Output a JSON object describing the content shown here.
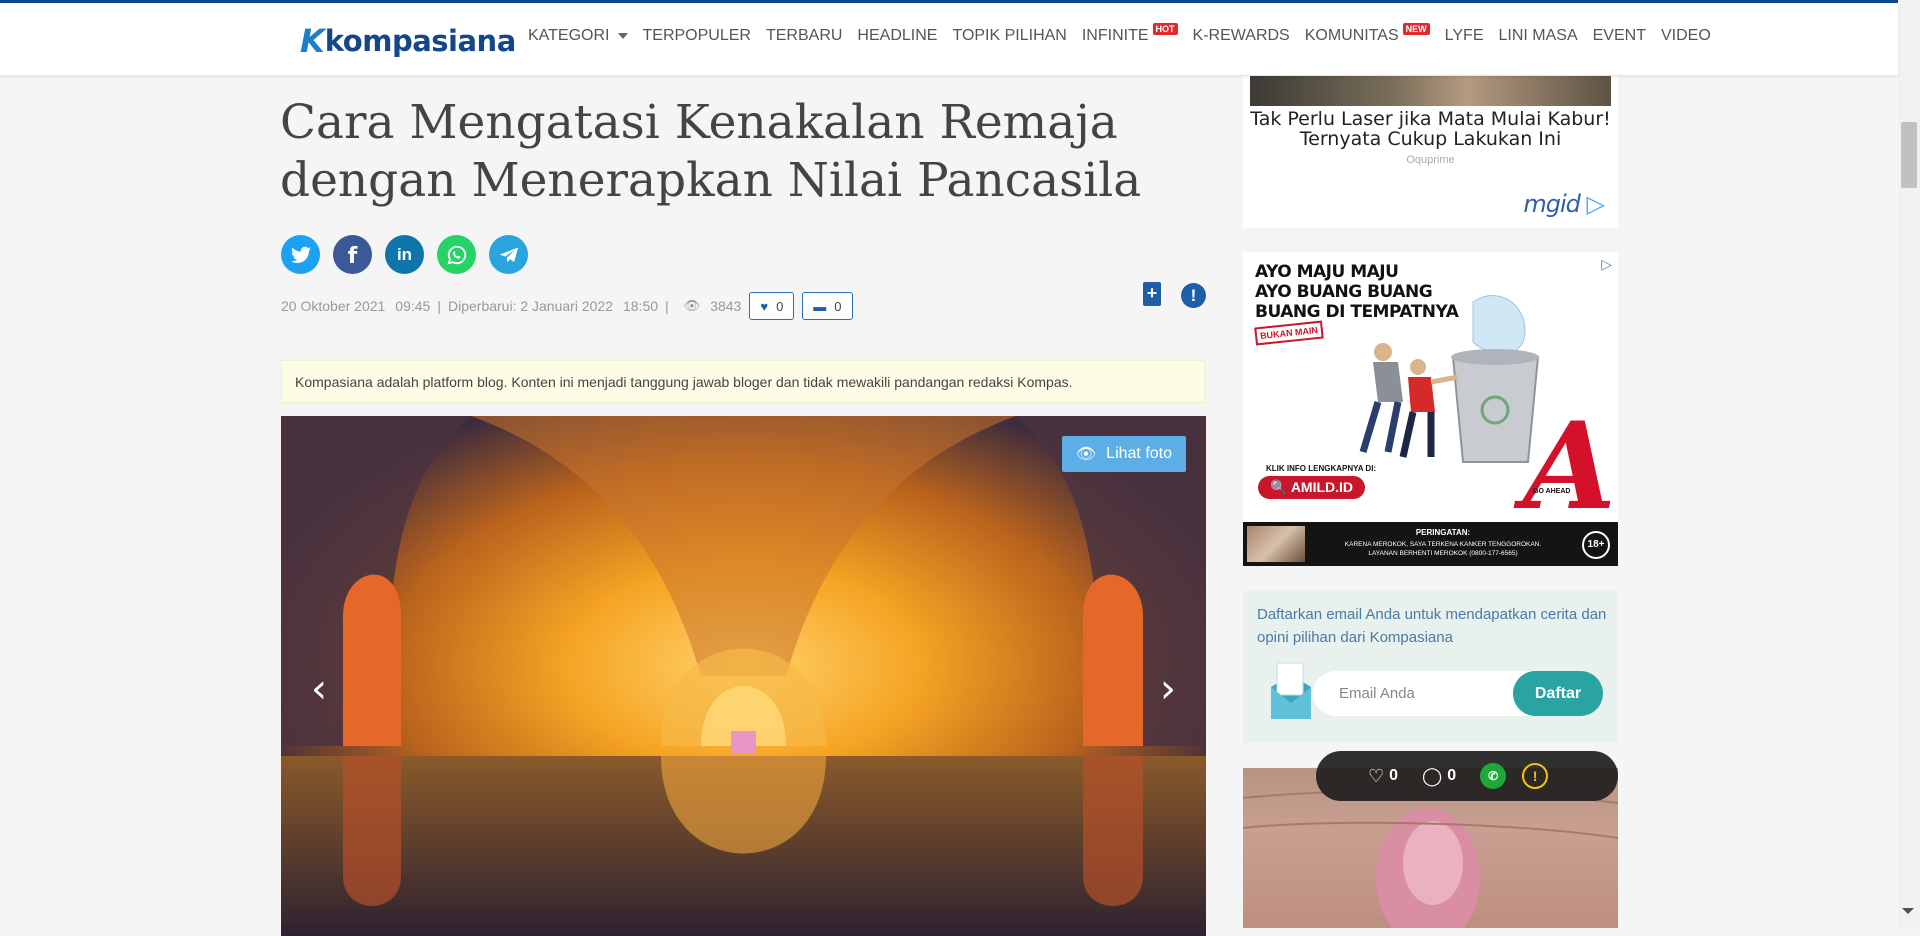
{
  "header": {
    "logo": {
      "mark": "K",
      "word": "kompasiana"
    },
    "nav": [
      {
        "label": "KATEGORI",
        "dropdown": true
      },
      {
        "label": "TERPOPULER"
      },
      {
        "label": "TERBARU"
      },
      {
        "label": "HEADLINE"
      },
      {
        "label": "TOPIK PILIHAN"
      },
      {
        "label": "INFINITE",
        "badge": "HOT"
      },
      {
        "label": "K-REWARDS"
      },
      {
        "label": "KOMUNITAS",
        "badge": "NEW"
      },
      {
        "label": "LYFE"
      },
      {
        "label": "LINI MASA"
      },
      {
        "label": "EVENT"
      },
      {
        "label": "VIDEO"
      }
    ]
  },
  "article": {
    "title": "Cara Mengatasi Kenakalan Remaja dengan Menerapkan Nilai Pancasila",
    "share": [
      {
        "name": "twitter-share-icon",
        "color": "#1da1f2",
        "glyph": "t"
      },
      {
        "name": "facebook-share-icon",
        "color": "#3b5998",
        "glyph": "f"
      },
      {
        "name": "linkedin-share-icon",
        "color": "#0e76a8",
        "glyph": "in"
      },
      {
        "name": "whatsapp-share-icon",
        "color": "#25d366",
        "glyph": "w"
      },
      {
        "name": "telegram-share-icon",
        "color": "#2aa3df",
        "glyph": "➤"
      }
    ],
    "meta": {
      "date": "20 Oktober 2021",
      "time": "09:45",
      "updated_label": "Diperbarui: 2 Januari 2022",
      "updated_time": "18:50",
      "separator": "|",
      "views": "3843",
      "likes": "0",
      "comments": "0"
    },
    "disclaimer": "Kompasiana adalah platform blog. Konten ini menjadi tanggung jawab bloger dan tidak mewakili pandangan redaksi Kompas.",
    "photo": {
      "view_button": "Lihat foto"
    }
  },
  "sidebar": {
    "ad1": {
      "title": "Tak Perlu Laser jika Mata Mulai Kabur! Ternyata Cukup Lakukan Ini",
      "source": "Oquprime",
      "brand": "mgid"
    },
    "ad2": {
      "headline_1": "AYO MAJU MAJU",
      "headline_2": "AYO BUANG BUANG",
      "headline_3": "BUANG DI TEMPATNYA",
      "stamp": "BUKAN MAIN",
      "info": "KLIK INFO LENGKAPNYA DI:",
      "url": "AMILD.ID",
      "letter": "A",
      "tagline": "GO AHEAD",
      "warning_title": "PERINGATAN:",
      "warning_text_1": "KARENA MEROKOK, SAYA TERKENA KANKER TENGGOROKAN.",
      "warning_text_2": "LAYANAN BERHENTI MEROKOK (0800-177-6565)",
      "age": "18+"
    },
    "newsletter": {
      "text": "Daftarkan email Anda untuk mendapatkan cerita dan opini pilihan dari Kompasiana",
      "placeholder": "Email Anda",
      "button": "Daftar"
    }
  },
  "floating_bar": {
    "likes": "0",
    "comments": "0"
  },
  "colors": {
    "brand_dark": "#14468a",
    "brand_light": "#1e7fc5",
    "accent": "#1e5fa8",
    "teal": "#2aa3a3"
  }
}
